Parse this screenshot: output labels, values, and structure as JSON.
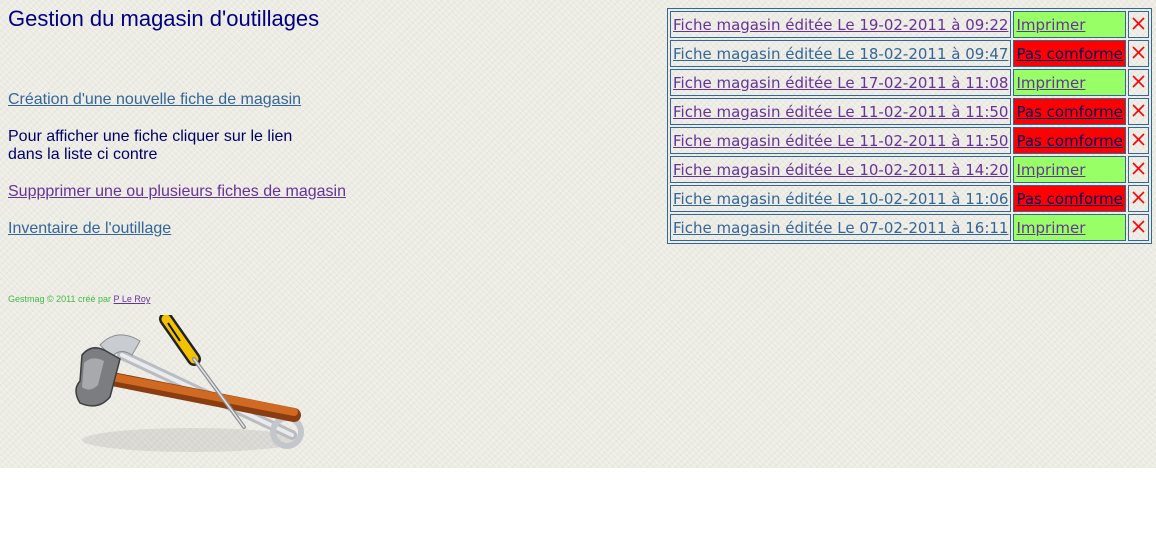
{
  "page": {
    "title": "Gestion du magasin d'outillages",
    "links": {
      "create": "Création d'une nouvelle fiche de magasin",
      "delete": "Suppprimer une ou plusieurs fiches de magasin",
      "inventory": "Inventaire de l'outillage"
    },
    "info_line1": "Pour afficher une fiche cliquer sur le lien",
    "info_line2": "dans la liste ci contre",
    "footer_text": "Gestmag © 2011 créé par",
    "footer_author": "P Le Roy"
  },
  "fiches": [
    {
      "label": "Fiche magasin éditée Le 19-02-2011 à 09:22",
      "status": "Imprimer",
      "status_color": "#99ff66",
      "visited": true
    },
    {
      "label": "Fiche magasin éditée Le 18-02-2011 à 09:47",
      "status": "Pas comforme",
      "status_color": "#ff0000",
      "visited": false
    },
    {
      "label": "Fiche magasin éditée Le 17-02-2011 à 11:08",
      "status": "Imprimer",
      "status_color": "#99ff66",
      "visited": true
    },
    {
      "label": "Fiche magasin éditée Le 11-02-2011 à 11:50",
      "status": "Pas comforme",
      "status_color": "#ff0000",
      "visited": true
    },
    {
      "label": "Fiche magasin éditée Le 11-02-2011 à 11:50",
      "status": "Pas comforme",
      "status_color": "#ff0000",
      "visited": true
    },
    {
      "label": "Fiche magasin éditée Le 10-02-2011 à 14:20",
      "status": "Imprimer",
      "status_color": "#99ff66",
      "visited": true
    },
    {
      "label": "Fiche magasin éditée Le 10-02-2011 à 11:06",
      "status": "Pas comforme",
      "status_color": "#ff0000",
      "visited": false
    },
    {
      "label": "Fiche magasin éditée Le 07-02-2011 à 16:11",
      "status": "Imprimer",
      "status_color": "#99ff66",
      "visited": false
    }
  ],
  "icons": {
    "delete": "close-icon",
    "illustration": "tools-illustration"
  },
  "colors": {
    "title": "#000080",
    "link": "#336699",
    "visited_link": "#663399",
    "ok_status": "#99ff66",
    "bad_status": "#ff0000",
    "delete_icon": "#ff0000"
  }
}
